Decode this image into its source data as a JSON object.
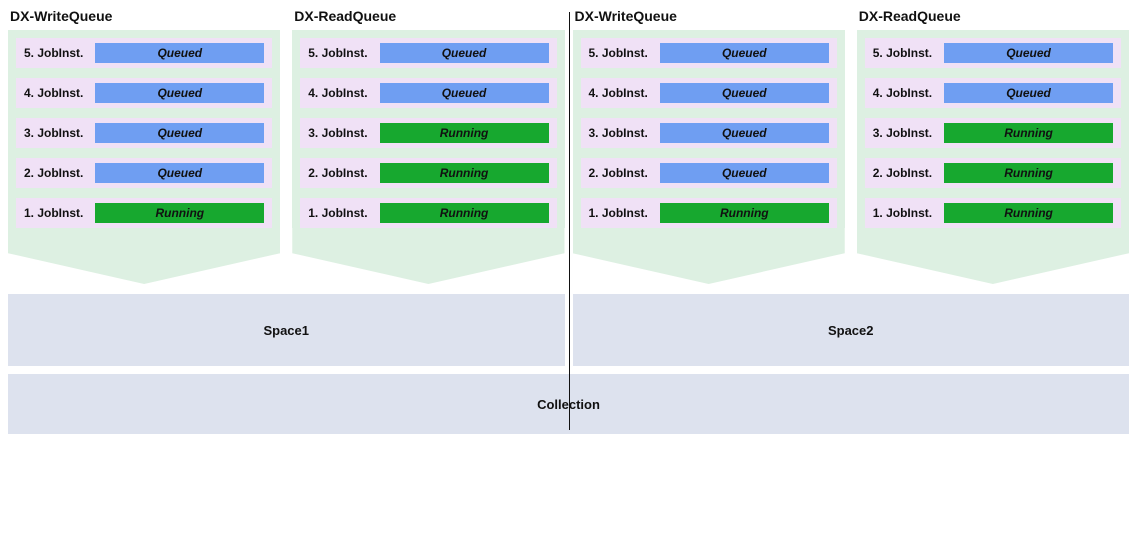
{
  "collection": {
    "label": "Collection"
  },
  "spaces": [
    {
      "id": "space1",
      "label": "Space1",
      "queues": [
        {
          "id": "space1-write",
          "title": "DX-WriteQueue",
          "jobs": [
            {
              "n": 5,
              "label": "5. JobInst.",
              "status": "Queued",
              "cls": "queued"
            },
            {
              "n": 4,
              "label": "4. JobInst.",
              "status": "Queued",
              "cls": "queued"
            },
            {
              "n": 3,
              "label": "3. JobInst.",
              "status": "Queued",
              "cls": "queued"
            },
            {
              "n": 2,
              "label": "2. JobInst.",
              "status": "Queued",
              "cls": "queued"
            },
            {
              "n": 1,
              "label": "1. JobInst.",
              "status": "Running",
              "cls": "running"
            }
          ]
        },
        {
          "id": "space1-read",
          "title": "DX-ReadQueue",
          "jobs": [
            {
              "n": 5,
              "label": "5. JobInst.",
              "status": "Queued",
              "cls": "queued"
            },
            {
              "n": 4,
              "label": "4. JobInst.",
              "status": "Queued",
              "cls": "queued"
            },
            {
              "n": 3,
              "label": "3. JobInst.",
              "status": "Running",
              "cls": "running"
            },
            {
              "n": 2,
              "label": "2. JobInst.",
              "status": "Running",
              "cls": "running"
            },
            {
              "n": 1,
              "label": "1. JobInst.",
              "status": "Running",
              "cls": "running"
            }
          ]
        }
      ]
    },
    {
      "id": "space2",
      "label": "Space2",
      "queues": [
        {
          "id": "space2-write",
          "title": "DX-WriteQueue",
          "jobs": [
            {
              "n": 5,
              "label": "5. JobInst.",
              "status": "Queued",
              "cls": "queued"
            },
            {
              "n": 4,
              "label": "4. JobInst.",
              "status": "Queued",
              "cls": "queued"
            },
            {
              "n": 3,
              "label": "3. JobInst.",
              "status": "Queued",
              "cls": "queued"
            },
            {
              "n": 2,
              "label": "2. JobInst.",
              "status": "Queued",
              "cls": "queued"
            },
            {
              "n": 1,
              "label": "1. JobInst.",
              "status": "Running",
              "cls": "running"
            }
          ]
        },
        {
          "id": "space2-read",
          "title": "DX-ReadQueue",
          "jobs": [
            {
              "n": 5,
              "label": "5. JobInst.",
              "status": "Queued",
              "cls": "queued"
            },
            {
              "n": 4,
              "label": "4. JobInst.",
              "status": "Queued",
              "cls": "queued"
            },
            {
              "n": 3,
              "label": "3. JobInst.",
              "status": "Running",
              "cls": "running"
            },
            {
              "n": 2,
              "label": "2. JobInst.",
              "status": "Running",
              "cls": "running"
            },
            {
              "n": 1,
              "label": "1. JobInst.",
              "status": "Running",
              "cls": "running"
            }
          ]
        }
      ]
    }
  ]
}
